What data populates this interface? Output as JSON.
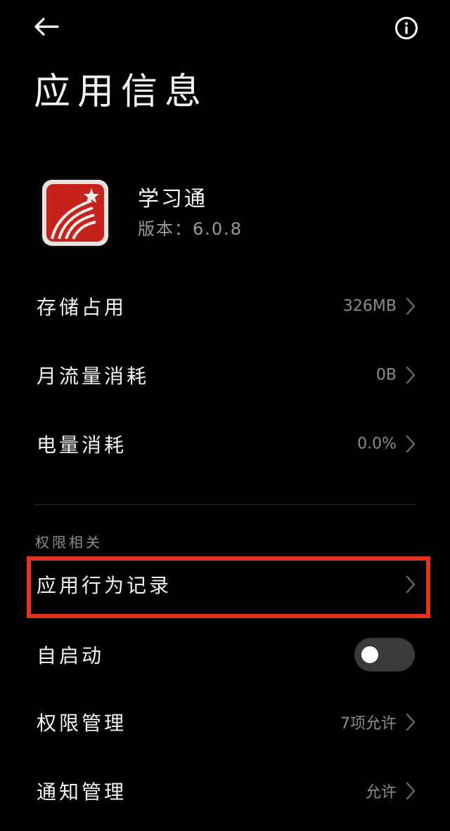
{
  "header": {
    "title": "应用信息",
    "back_icon": "arrow-left-icon",
    "info_icon": "info-circle-icon"
  },
  "app": {
    "name": "学习通",
    "version": "版本：6.0.8",
    "icon": "xuexitong-app-icon",
    "icon_bg": "#e9e4de",
    "icon_accent": "#c7211b"
  },
  "rows_top": [
    {
      "label": "存储占用",
      "value": "326MB"
    },
    {
      "label": "月流量消耗",
      "value": "0B"
    },
    {
      "label": "电量消耗",
      "value": "0.0%"
    }
  ],
  "permissions": {
    "section_title": "权限相关",
    "behavior_record": {
      "label": "应用行为记录",
      "value": ""
    },
    "autostart": {
      "label": "自启动",
      "enabled": false
    },
    "permission_mgmt": {
      "label": "权限管理",
      "value": "7项允许"
    },
    "notification_mgmt": {
      "label": "通知管理",
      "value": "允许"
    }
  },
  "colors": {
    "background": "#000000",
    "highlight": "#e4321d",
    "secondary_text": "#8c8c8c"
  }
}
